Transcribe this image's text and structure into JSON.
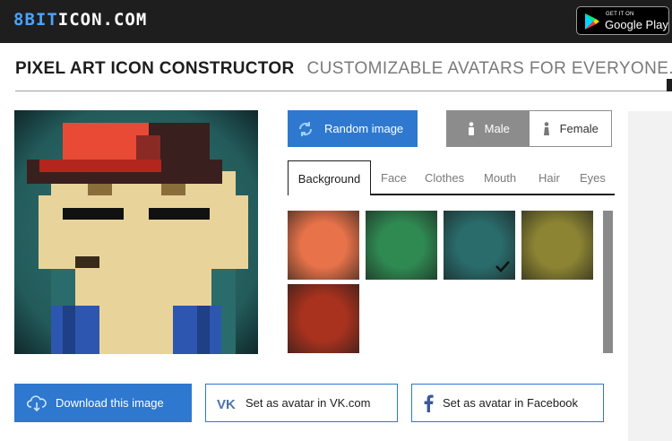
{
  "site": {
    "logo_accent": "8BIT",
    "logo_rest": "ICON.COM"
  },
  "store_badge": {
    "small": "GET IT ON",
    "big": "Google Play"
  },
  "heading": {
    "bold": "PIXEL ART ICON CONSTRUCTOR",
    "light": "CUSTOMIZABLE AVATARS FOR EVERYONE."
  },
  "controls": {
    "random_label": "Random image",
    "gender": [
      {
        "label": "Male",
        "icon": "male-icon",
        "selected": true
      },
      {
        "label": "Female",
        "icon": "female-icon",
        "selected": false
      }
    ]
  },
  "tabs": [
    {
      "label": "Background",
      "active": true
    },
    {
      "label": "Face",
      "active": false
    },
    {
      "label": "Clothes",
      "active": false
    },
    {
      "label": "Mouth",
      "active": false
    },
    {
      "label": "Hair",
      "active": false
    },
    {
      "label": "Eyes",
      "active": false
    }
  ],
  "swatches": [
    {
      "color": "#e8734a",
      "selected": false
    },
    {
      "color": "#2f8a52",
      "selected": false
    },
    {
      "color": "#2a6b6b",
      "selected": true
    },
    {
      "color": "#8c8433",
      "selected": false
    },
    {
      "color": "#a8321e",
      "selected": false
    }
  ],
  "actions": {
    "download": "Download this image",
    "vk": "Set as avatar in VK.com",
    "facebook": "Set as avatar in Facebook"
  },
  "colors": {
    "topbar": "#1e1e1e",
    "accent_blue": "#2e78cf",
    "avatar_background": "#2a6b6b",
    "skin": "#e8d49a",
    "cap_red": "#e84a35",
    "cap_dark": "#3a1f1f",
    "shirt_blue": "#2d56b0"
  }
}
